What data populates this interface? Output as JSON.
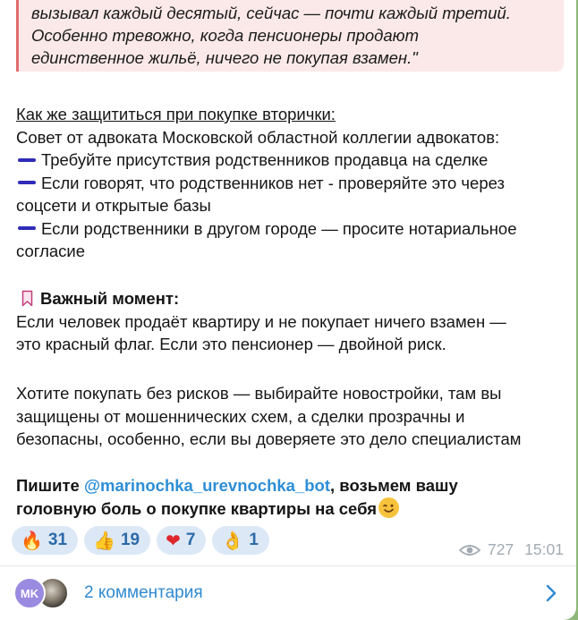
{
  "quote": {
    "lines": [
      "вызывал каждый десятый, сейчас — почти каждый третий.",
      "Особенно тревожно, когда пенсионеры продают",
      "единственное жильё, ничего не покупая взамен.\""
    ]
  },
  "post": {
    "heading": "Как же защититься при покупке вторички:",
    "intro": "Совет от адвоката Московской областной коллегии адвокатов:",
    "tips": [
      {
        "line1": "Требуйте присутствия родственников продавца на сделке",
        "line2": ""
      },
      {
        "line1": "Если говорят, что родственников нет - проверяйте это через",
        "line2": "соцсети и открытые базы"
      },
      {
        "line1": "Если родственники в другом городе — просите нотариальное",
        "line2": "согласие"
      }
    ],
    "important_title": "Важный момент:",
    "important_lines": [
      "Если человек продаёт квартиру и не покупает ничего взамен —",
      "это красный флаг. Если это пенсионер — двойной риск."
    ],
    "advice_lines": [
      "Хотите покупать без рисков — выбирайте новостройки, там вы",
      "защищены от мошеннических схем, а сделки прозрачны и",
      "безопасны, особенно, если вы доверяете это дело специалистам"
    ],
    "cta_prefix": "Пишите ",
    "cta_mention": "@marinochka_urevnochka_bot",
    "cta_suffix": ", возьмем вашу",
    "cta_line2": "головную боль о покупке квартиры на себя"
  },
  "reactions": [
    {
      "icon": "🔥",
      "icon_name": "fire-icon",
      "count": "31"
    },
    {
      "icon": "👍",
      "icon_name": "thumbs-up-icon",
      "count": "19"
    },
    {
      "icon": "❤",
      "icon_name": "heart-on-fire-icon",
      "count": "7"
    },
    {
      "icon": "👌",
      "icon_name": "ok-hand-icon",
      "count": "1"
    }
  ],
  "meta": {
    "views": "727",
    "time": "15:01"
  },
  "comments": {
    "avatar_initials": "MK",
    "label": "2 комментария"
  },
  "colors": {
    "accent": "#2d8ed6",
    "quote_border": "#e06c6c",
    "dash": "#2f2bb8",
    "reaction_bg": "#dde8f6"
  }
}
